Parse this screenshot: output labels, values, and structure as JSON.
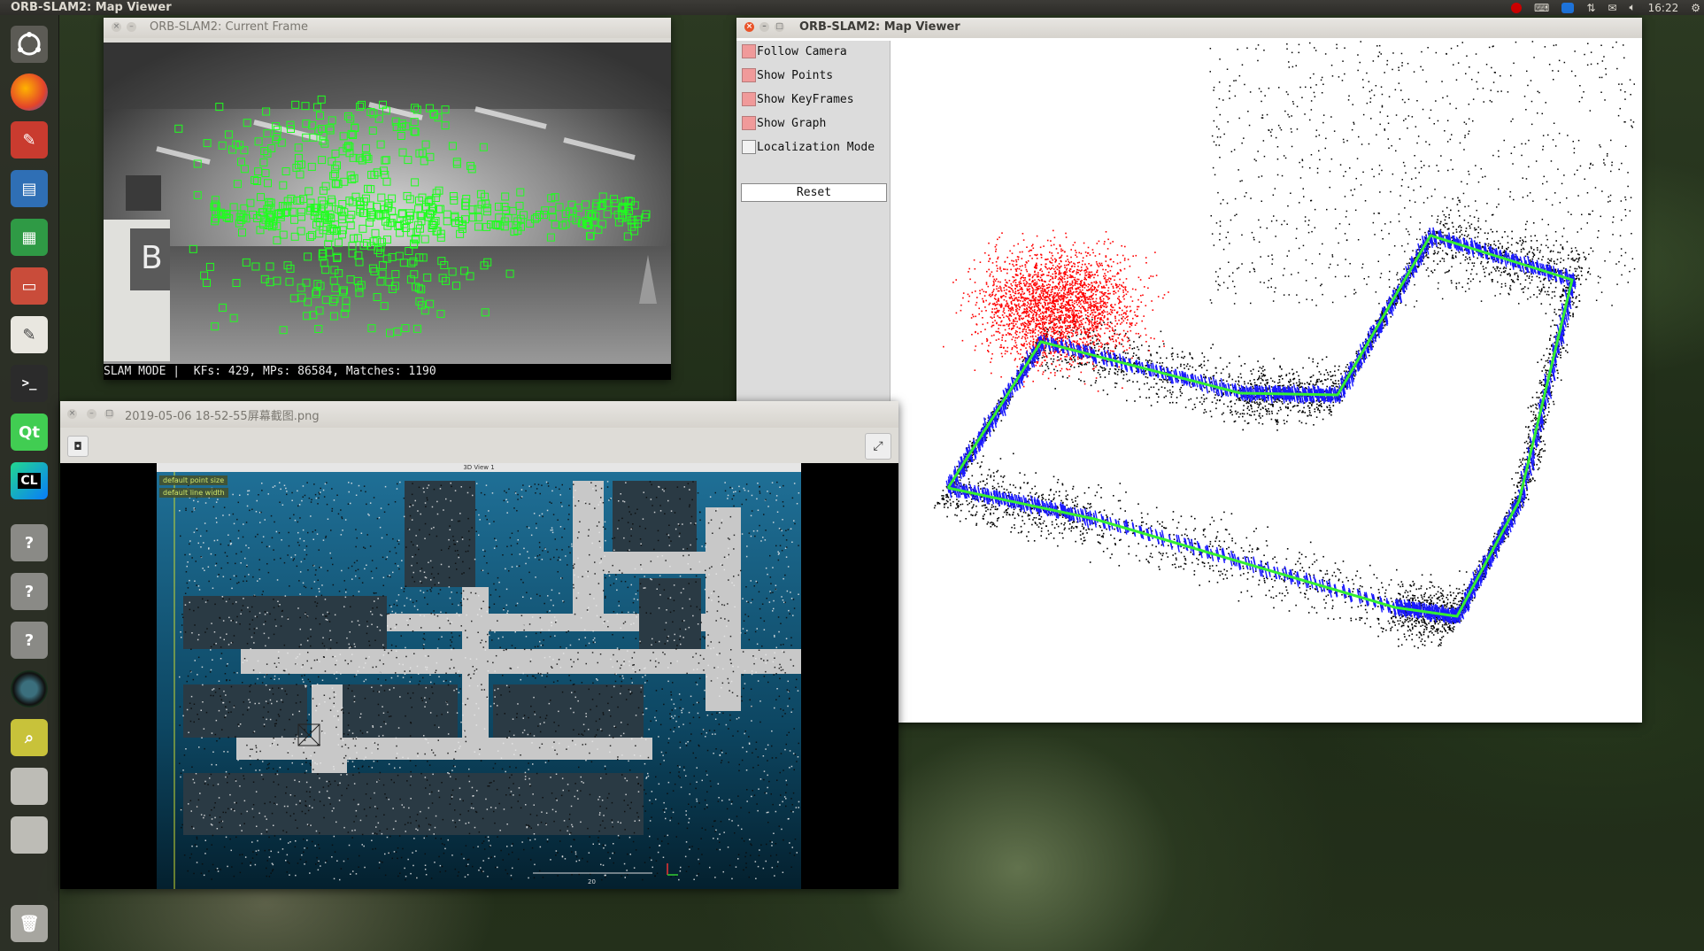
{
  "topbar": {
    "title": "ORB-SLAM2: Map Viewer",
    "time": "16:22"
  },
  "launcher": {
    "items": [
      "ubuntu-logo-icon",
      "firefox-icon",
      "settings-icon",
      "writer-icon",
      "calc-icon",
      "files-icon",
      "text-editor-icon",
      "terminal-icon",
      "qt-creator-icon",
      "clion-icon",
      "unknown-app-icon",
      "unknown-app-icon",
      "unknown-app-icon",
      "cheese-icon",
      "image-viewer-icon",
      "disk-icon",
      "disk-icon",
      "trash-icon"
    ],
    "clion_label": "CL",
    "qt_label": "Qt",
    "unknown_label": "?"
  },
  "current_frame": {
    "title": "ORB-SLAM2: Current Frame",
    "status": "SLAM MODE |  KFs: 429, MPs: 86584, Matches: 1190",
    "sign_letter": "B"
  },
  "map_viewer": {
    "title": "ORB-SLAM2: Map Viewer",
    "options": [
      {
        "label": "Follow Camera",
        "checked": true
      },
      {
        "label": "Show Points",
        "checked": true
      },
      {
        "label": "Show KeyFrames",
        "checked": true
      },
      {
        "label": "Show Graph",
        "checked": true
      },
      {
        "label": "Localization Mode",
        "checked": false
      }
    ],
    "reset_label": "Reset"
  },
  "image_viewer": {
    "title": "2019-05-06 18-52-55屏幕截图.png",
    "inner_title": "3D View 1",
    "chip_point_size": "default point size",
    "chip_line_width": "default line width",
    "scale_label": "20"
  },
  "colors": {
    "feature": "#1eff1e",
    "ref_points": "#ff0000",
    "keyframes": "#1a1aff",
    "graph": "#33ee33",
    "map_points": "#000000"
  }
}
